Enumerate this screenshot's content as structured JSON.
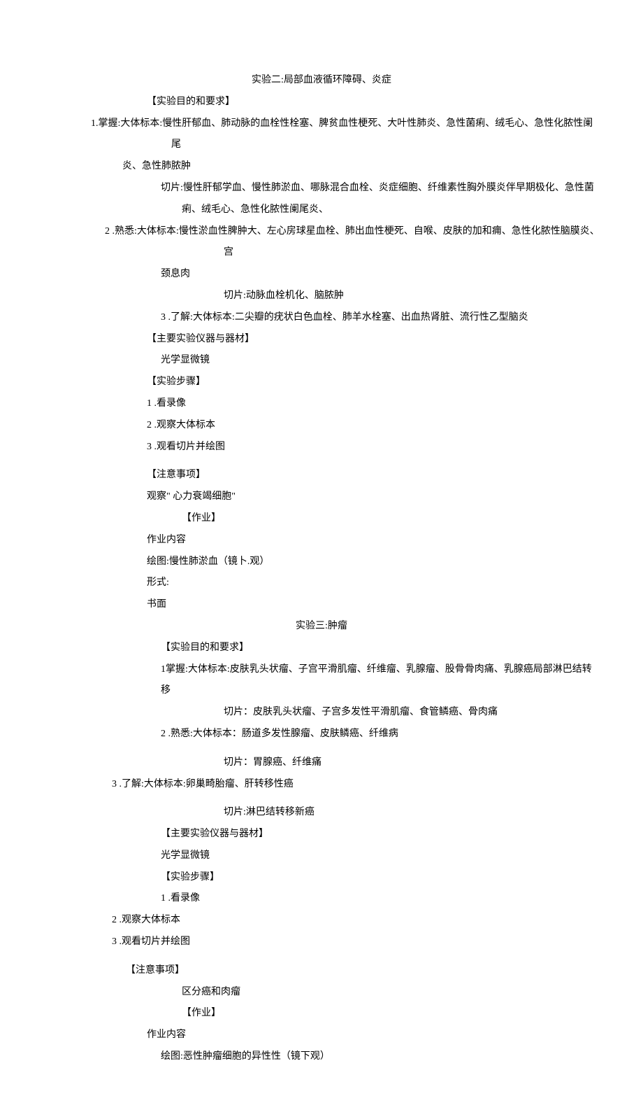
{
  "exp2": {
    "title": "实验二:局部血液循环障碍、炎症",
    "sec_purpose_h": "【实验目的和要求】",
    "purpose1": "1.掌握:大体标本:慢性肝郁血、肺动脉的血栓性栓塞、脾贫血性梗死、大叶性肺炎、急性菌痢、绒毛心、急性化脓性阑尾",
    "purpose1b": "炎、急性肺脓肿",
    "purpose1c": "切片:慢性肝郁学血、慢性肺淤血、哪脉混合血栓、炎症细胞、纤维素性胸外膜炎伴早期极化、急性菌",
    "purpose1d": "痢、绒毛心、急性化脓性阑尾炎、",
    "purpose2": "2  .熟悉:大体标本:慢性淤血性脾肿大、左心房球星血栓、肺出血性梗死、自喉、皮肤的加和痈、急性化脓性脑膜炎、宫",
    "purpose2b": "颈息肉",
    "purpose2c": "切片:动脉血栓机化、脑脓肿",
    "purpose3": "3  .了解:大体标本:二尖瓣的疣状白色血栓、肺羊水栓塞、出血热肾脏、流行性乙型脑炎",
    "sec_device_h": "【主要实验仪器与器材】",
    "device": "光学显微镜",
    "sec_steps_h": "【实验步骤】",
    "step1": "1  .看录像",
    "step2": "2  .观察大体标本",
    "step3": "3  .观看切片并绘图",
    "sec_note_h": "【注意事项】",
    "note": "观察\" 心力衰竭细胞\"",
    "sec_hw_h": "【作业】",
    "hw1": "作业内容",
    "hw2": "绘图:慢性肺淤血（镜卜.观）",
    "hw3": "形式:",
    "hw4": "书面"
  },
  "exp3": {
    "title": "实验三:肿瘤",
    "sec_purpose_h": "【实验目的和要求】",
    "purpose1": "1掌握:大体标本:皮肤乳头状瘤、子宫平滑肌瘤、纤维瘤、乳腺瘤、股骨骨肉痛、乳腺癌局部淋巴结转移",
    "purpose1b": "切片：皮肤乳头状瘤、子宫多发性平滑肌瘤、食管鳞癌、骨肉痛",
    "purpose2": "2  .熟悉:大体标本：肠道多发性腺瘤、皮肤鳞癌、纤维病",
    "purpose2b": "切片：胃腺癌、纤维痛",
    "purpose3": "3  .了解:大体标本:卵巢畸胎瘤、肝转移性癌",
    "purpose3b": "切片:淋巴结转移新癌",
    "sec_device_h": "【主要实验仪器与器材】",
    "device": "光学显微镜",
    "sec_steps_h": "【实验步骤】",
    "step1": "1  .看录像",
    "step2": "2  .观察大体标本",
    "step3": "3  .观看切片并绘图",
    "sec_note_h": "【注意事项】",
    "note": "区分癌和肉瘤",
    "sec_hw_h": "【作业】",
    "hw1": "作业内容",
    "hw2": "绘图:恶性肿瘤细胞的异性性（镜下观）"
  }
}
